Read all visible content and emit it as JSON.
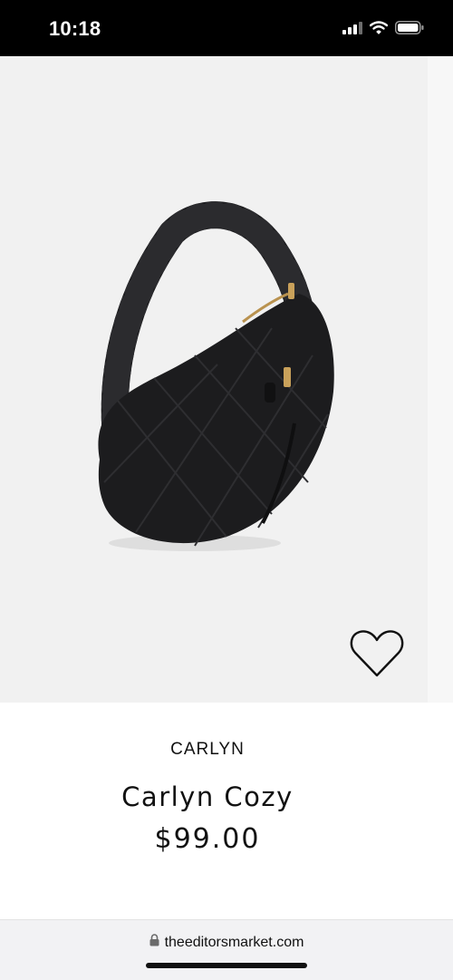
{
  "status_bar": {
    "time": "10:18",
    "icons": [
      "cellular-signal-icon",
      "wifi-icon",
      "battery-icon"
    ]
  },
  "gallery": {
    "image": "black-quilted-crescent-hobo-bag",
    "wishlist_icon": "heart-outline-icon"
  },
  "product": {
    "brand": "CARLYN",
    "title": "Carlyn Cozy",
    "price": "$99.00"
  },
  "browser": {
    "url": "theeditorsmarket.com",
    "lock_icon": "lock-icon"
  },
  "colors": {
    "status_bar_bg": "#000000",
    "gallery_bg": "#f1f1f1",
    "bag": "#1c1c1e",
    "zipper_gold": "#c9a15a",
    "text": "#111111",
    "url_bar_bg": "#f2f2f4"
  }
}
